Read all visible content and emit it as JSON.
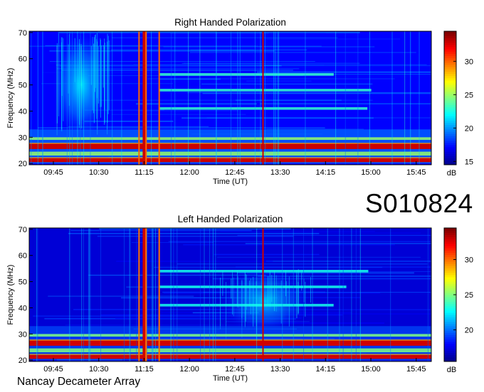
{
  "page": {
    "observation_id": "S010824",
    "footer": "Nancay Decameter Array"
  },
  "chart_data": [
    {
      "type": "heatmap",
      "title": "Right Handed Polarization",
      "xlabel": "Time (UT)",
      "ylabel": "Frequency (MHz)",
      "x_ticks": [
        "09:45",
        "10:30",
        "11:15",
        "12:00",
        "12:45",
        "13:30",
        "14:15",
        "15:00",
        "15:45"
      ],
      "y_ticks": [
        20,
        30,
        40,
        50,
        60,
        70
      ],
      "ylim": [
        19.5,
        70.5
      ],
      "xlim_hours": [
        9.35,
        16.0
      ],
      "colorbar": {
        "label": "dB",
        "ticks": [
          15,
          20,
          25,
          30
        ],
        "range": [
          14.5,
          34.5
        ],
        "colormap": [
          "#00008f",
          "#0000ff",
          "#0080ff",
          "#00ffff",
          "#80ff80",
          "#ffff00",
          "#ff8000",
          "#ff0000",
          "#800000"
        ]
      },
      "background_level_db": 17,
      "features": {
        "intense_bands_mhz": [
          [
            20.5,
            22.0
          ],
          [
            25.5,
            27.5
          ]
        ],
        "moderate_bands_mhz": [
          [
            23.0,
            24.5
          ],
          [
            29.0,
            30.0
          ],
          [
            40.5,
            41.5
          ],
          [
            47.5,
            48.5
          ],
          [
            53.5,
            54.5
          ]
        ],
        "broadband_bursts_ut": [
          "11:10",
          "11:15",
          "11:17",
          "11:30",
          "13:13"
        ],
        "diffuse_emission": {
          "time_range_ut": [
            "09:45",
            "10:40"
          ],
          "freq_range_mhz": [
            30,
            70
          ]
        }
      }
    },
    {
      "type": "heatmap",
      "title": "Left Handed Polarization",
      "xlabel": "Time (UT)",
      "ylabel": "Frequency (MHz)",
      "x_ticks": [
        "09:45",
        "10:30",
        "11:15",
        "12:00",
        "12:45",
        "13:30",
        "14:15",
        "15:00",
        "15:45"
      ],
      "y_ticks": [
        20,
        30,
        40,
        50,
        60,
        70
      ],
      "ylim": [
        19.5,
        70.5
      ],
      "xlim_hours": [
        9.35,
        16.0
      ],
      "colorbar": {
        "label": "dB",
        "ticks": [
          20,
          25,
          30
        ],
        "range": [
          15.5,
          34.5
        ],
        "colormap": [
          "#00008f",
          "#0000ff",
          "#0080ff",
          "#00ffff",
          "#80ff80",
          "#ffff00",
          "#ff8000",
          "#ff0000",
          "#800000"
        ]
      },
      "background_level_db": 17,
      "features": {
        "intense_bands_mhz": [
          [
            20.5,
            22.0
          ],
          [
            25.5,
            27.5
          ]
        ],
        "moderate_bands_mhz": [
          [
            23.0,
            24.5
          ],
          [
            29.0,
            30.0
          ],
          [
            40.5,
            41.5
          ],
          [
            47.5,
            48.5
          ],
          [
            53.5,
            54.5
          ]
        ],
        "broadband_bursts_ut": [
          "11:10",
          "11:15",
          "11:17",
          "11:30",
          "13:13"
        ],
        "diffuse_emission": {
          "time_range_ut": [
            "12:30",
            "14:00"
          ],
          "freq_range_mhz": [
            30,
            55
          ]
        }
      }
    }
  ]
}
